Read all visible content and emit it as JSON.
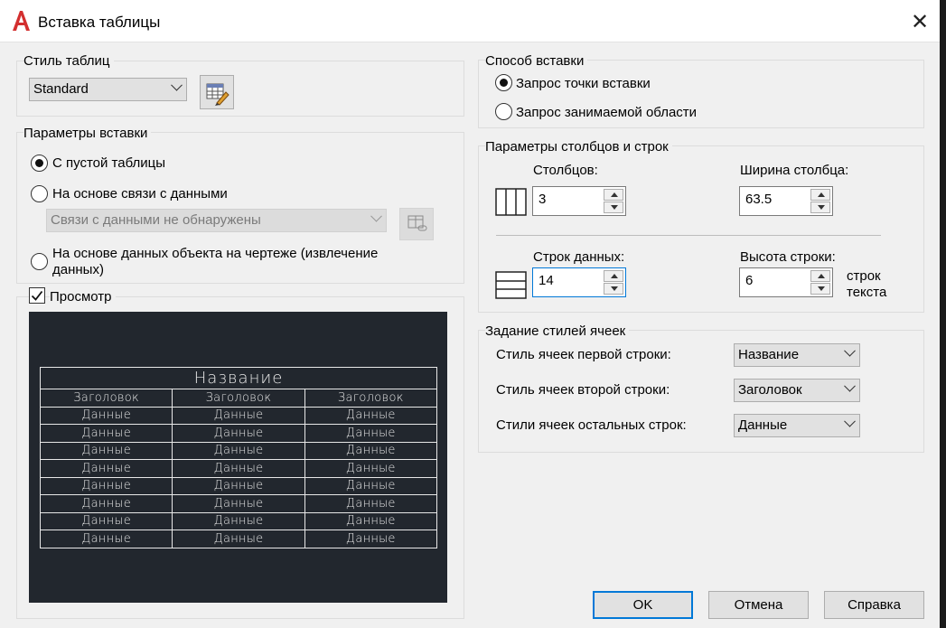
{
  "window": {
    "title": "Вставка таблицы",
    "close_glyph": "✕",
    "accent_color": "#0078d7",
    "app_icon": "autocad-logo-icon"
  },
  "table_style": {
    "group_label": "Стиль таблиц",
    "selected": "Standard",
    "edit_icon": "table-style-edit-icon"
  },
  "insert_options": {
    "group_label": "Параметры вставки",
    "options": [
      {
        "label": "С пустой таблицы",
        "checked": true
      },
      {
        "label": "На основе связи с данными",
        "checked": false
      },
      {
        "label": "На основе данных объекта на чертеже (извлечение данных)",
        "checked": false
      }
    ],
    "data_link_select": "Связи с данными не обнаружены",
    "data_link_icon": "data-link-manager-icon"
  },
  "preview": {
    "checkbox_label": "Просмотр",
    "checked": true,
    "title_cell": "Название",
    "header_cells": [
      "Заголовок",
      "Заголовок",
      "Заголовок"
    ],
    "data_cell": "Данные",
    "data_rows": 8,
    "background_color": "#22272e"
  },
  "insert_method": {
    "group_label": "Способ вставки",
    "options": [
      {
        "label": "Запрос точки вставки",
        "checked": true
      },
      {
        "label": "Запрос занимаемой области",
        "checked": false
      }
    ]
  },
  "column_row": {
    "group_label": "Параметры столбцов и строк",
    "columns_label": "Столбцов:",
    "columns_value": "3",
    "col_width_label": "Ширина столбца:",
    "col_width_value": "63.5",
    "data_rows_label": "Строк данных:",
    "data_rows_value": "14",
    "row_height_label": "Высота строки:",
    "row_height_value": "6",
    "row_height_unit": "строк текста"
  },
  "cell_styles": {
    "group_label": "Задание стилей ячеек",
    "rows": [
      {
        "label": "Стиль ячеек первой строки:",
        "value": "Название"
      },
      {
        "label": "Стиль ячеек второй строки:",
        "value": "Заголовок"
      },
      {
        "label": "Стили ячеек остальных строк:",
        "value": "Данные"
      }
    ]
  },
  "buttons": {
    "ok": "OK",
    "cancel": "Отмена",
    "help": "Справка"
  }
}
